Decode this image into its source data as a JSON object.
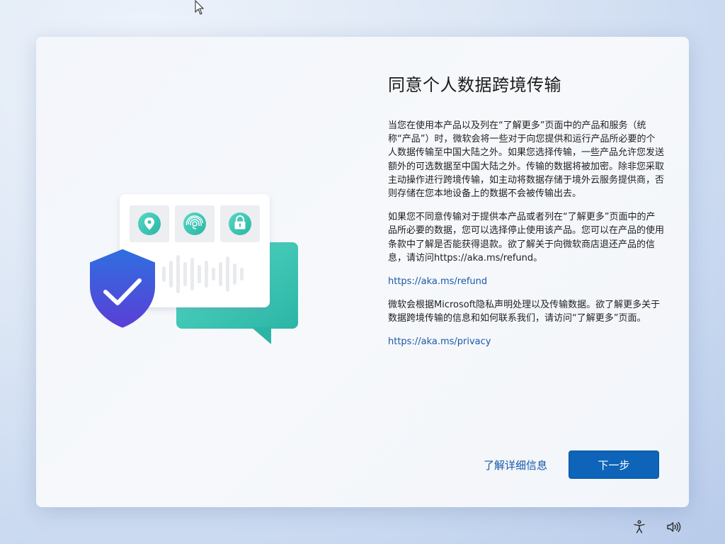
{
  "dialog": {
    "title": "同意个人数据跨境传输",
    "paragraphs": [
      "当您在使用本产品以及列在“了解更多”页面中的产品和服务（统称“产品”）时，微软会将一些对于向您提供和运行产品所必要的个人数据传输至中国大陆之外。如果您选择传输，一些产品允许您发送额外的可选数据至中国大陆之外。传输的数据将被加密。除非您采取主动操作进行跨境传输，如主动将数据存储于境外云服务提供商，否则存储在您本地设备上的数据不会被传输出去。",
      "如果您不同意传输对于提供本产品或者列在“了解更多”页面中的产品所必要的数据，您可以选择停止使用该产品。您可以在产品的使用条款中了解是否能获得退款。欲了解关于向微软商店退还产品的信息，请访问https://aka.ms/refund。",
      "微软会根据Microsoft隐私声明处理以及传输数据。欲了解更多关于数据跨境传输的信息和如何联系我们，请访问“了解更多”页面。"
    ],
    "refund_link": "https://aka.ms/refund",
    "privacy_link": "https://aka.ms/privacy",
    "learn_more_label": "了解详细信息",
    "next_label": "下一步"
  },
  "colors": {
    "accent": "#0d64b8",
    "link": "#1b5aa6",
    "shield_top": "#2f6fe0",
    "shield_bottom": "#5a3fd6",
    "bubble_teal": "#3ec9b4"
  },
  "icons": {
    "cursor": "mouse-pointer-icon",
    "location": "location-pin-icon",
    "fingerprint": "fingerprint-icon",
    "lock": "lock-icon",
    "shield": "shield-check-icon",
    "accessibility": "accessibility-icon",
    "volume": "volume-icon"
  }
}
